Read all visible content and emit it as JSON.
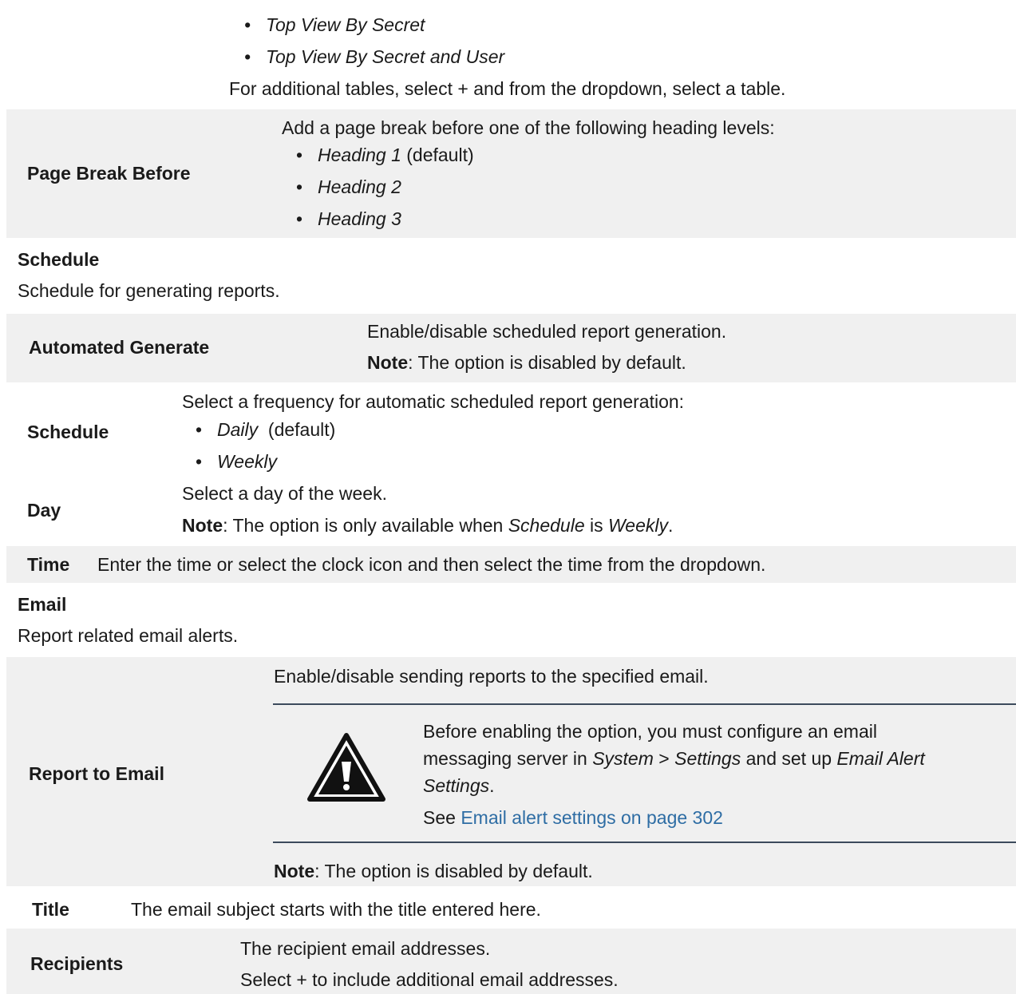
{
  "pre_table": {
    "bullets": [
      "Top View By Secret",
      "Top View By Secret and User"
    ],
    "additional": "For additional tables, select + and from the dropdown, select a table."
  },
  "page_break": {
    "label": "Page Break Before",
    "intro": "Add a page break before one of the following heading levels:",
    "options": [
      {
        "name": "Heading 1",
        "suffix": " (default)"
      },
      {
        "name": "Heading 2",
        "suffix": ""
      },
      {
        "name": "Heading 3",
        "suffix": ""
      }
    ]
  },
  "schedule_section": {
    "heading": "Schedule",
    "description": "Schedule for generating reports.",
    "automated": {
      "label": "Automated Generate",
      "desc": "Enable/disable scheduled report generation.",
      "note_label": "Note",
      "note_text": ": The option is disabled by default."
    },
    "schedule": {
      "label": "Schedule",
      "desc": "Select a frequency for automatic scheduled report generation:",
      "options": [
        {
          "name": "Daily",
          "suffix": "  (default)"
        },
        {
          "name": "Weekly",
          "suffix": ""
        }
      ]
    },
    "day": {
      "label": "Day",
      "desc": "Select a day of the week.",
      "note_label": "Note",
      "note_pre": ": The option is only available when ",
      "note_italic1": "Schedule",
      "note_mid": " is ",
      "note_italic2": "Weekly",
      "note_end": "."
    },
    "time": {
      "label": "Time",
      "desc": "Enter the time or select the clock icon and then select the time from the dropdown."
    }
  },
  "email_section": {
    "heading": "Email",
    "description": "Report related email alerts.",
    "report_to_email": {
      "label": "Report to Email",
      "desc": "Enable/disable sending reports to the specified email.",
      "warning": {
        "icon": "warning-icon",
        "line1": "Before enabling the option, you must configure an email",
        "line2_pre": "messaging server in ",
        "line2_italic1": "System",
        "line2_mid1": " > ",
        "line2_italic2": "Settings",
        "line2_mid2": " and set up ",
        "line2_italic3": "Email Alert",
        "line3_italic": "Settings",
        "line3_end": ".",
        "see_pre": "See ",
        "see_link": "Email alert settings on page 302"
      },
      "note_label": "Note",
      "note_text": ": The option is disabled by default."
    },
    "title": {
      "label": "Title",
      "desc": "The email subject starts with the title entered here."
    },
    "recipients": {
      "label": "Recipients",
      "desc1": "The recipient email addresses.",
      "desc2": "Select + to include additional email addresses."
    }
  },
  "colors": {
    "band": "#f0f0f0",
    "rule": "#3c4a5c",
    "link": "#2e6da4"
  }
}
